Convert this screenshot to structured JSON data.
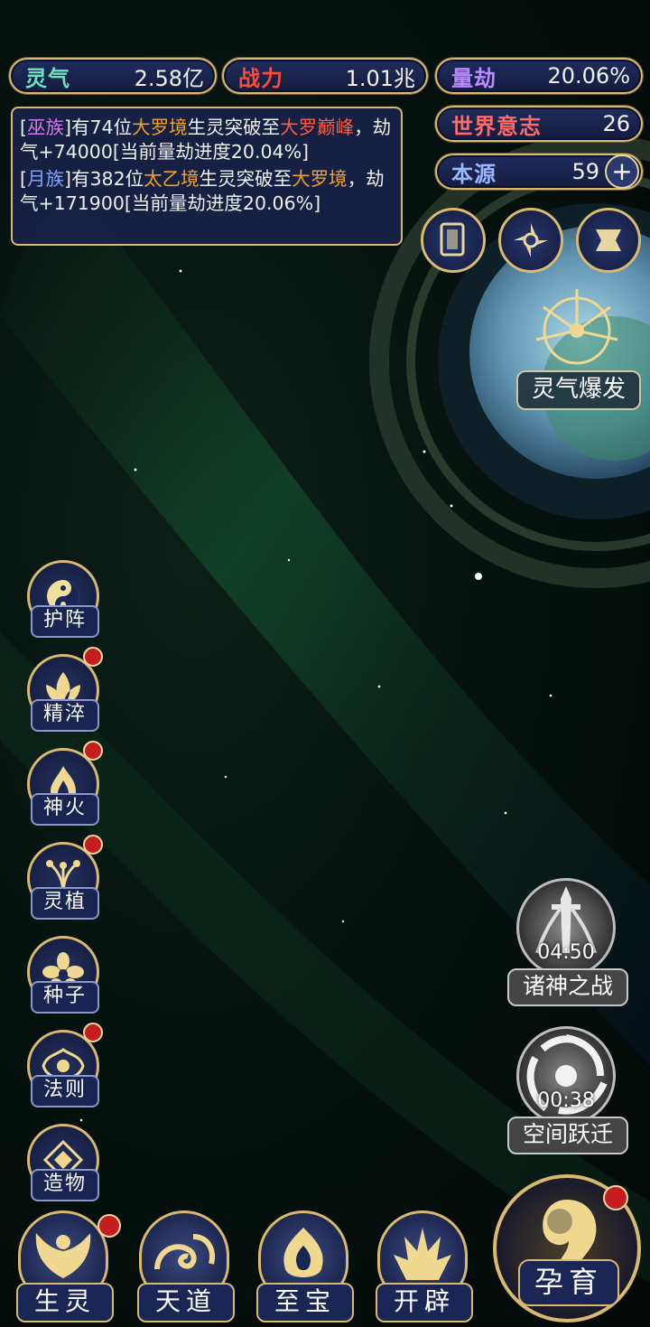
{
  "stats": {
    "lingqi": {
      "label": "灵气",
      "value": "2.58亿",
      "label_color": "#6fe0c0"
    },
    "zhanli": {
      "label": "战力",
      "value": "1.01兆",
      "label_color": "#ff4a3a"
    },
    "liangjie": {
      "label": "量劫",
      "value": "20.06%",
      "label_color": "#b98cff"
    },
    "shijie": {
      "label": "世界意志",
      "value": "26",
      "label_color": "#ff6a6a"
    },
    "benyuan": {
      "label": "本源",
      "value": "59",
      "label_color": "#9ab6ff",
      "plus": "+"
    }
  },
  "log": {
    "entry1": {
      "open": "[",
      "clan": "巫族",
      "t1": "]有74位",
      "realm": "大罗境",
      "t2": "生灵突破至",
      "target": "大罗巅峰",
      "t3": "，劫气+74000[当前量劫进度20.04%]"
    },
    "entry2": {
      "open": "[",
      "clan": "月族",
      "t1": "]有382位",
      "realm": "太乙境",
      "t2": "生灵突破至",
      "target": "大罗境",
      "t3": "，劫气+171900[当前量劫进度20.06%]"
    }
  },
  "burst": {
    "label": "灵气爆发"
  },
  "side_menu": [
    {
      "label": "护阵",
      "icon": "taiji-icon",
      "badge": false
    },
    {
      "label": "精淬",
      "icon": "lotus-flame-icon",
      "badge": true
    },
    {
      "label": "神火",
      "icon": "divine-fire-icon",
      "badge": true
    },
    {
      "label": "灵植",
      "icon": "spirit-plant-icon",
      "badge": true
    },
    {
      "label": "种子",
      "icon": "seed-flower-icon",
      "badge": false
    },
    {
      "label": "法则",
      "icon": "law-icon",
      "badge": true
    },
    {
      "label": "造物",
      "icon": "creation-icon",
      "badge": false
    }
  ],
  "events": [
    {
      "timer": "04:50",
      "label": "诸神之战",
      "icon": "sword-icon"
    },
    {
      "timer": "00:38",
      "label": "空间跃迁",
      "icon": "vortex-icon"
    }
  ],
  "bottom_nav": [
    {
      "label": "生灵",
      "icon": "phoenix-icon",
      "badge": true
    },
    {
      "label": "天道",
      "icon": "cloud-swirl-icon",
      "badge": false
    },
    {
      "label": "至宝",
      "icon": "treasure-flame-icon",
      "badge": false
    },
    {
      "label": "开辟",
      "icon": "axe-icon",
      "badge": false
    }
  ],
  "nurture": {
    "label": "孕育",
    "icon": "embryo-icon",
    "badge": true
  },
  "top_buttons": [
    "card-icon",
    "shuriken-icon",
    "scroll-icon"
  ]
}
